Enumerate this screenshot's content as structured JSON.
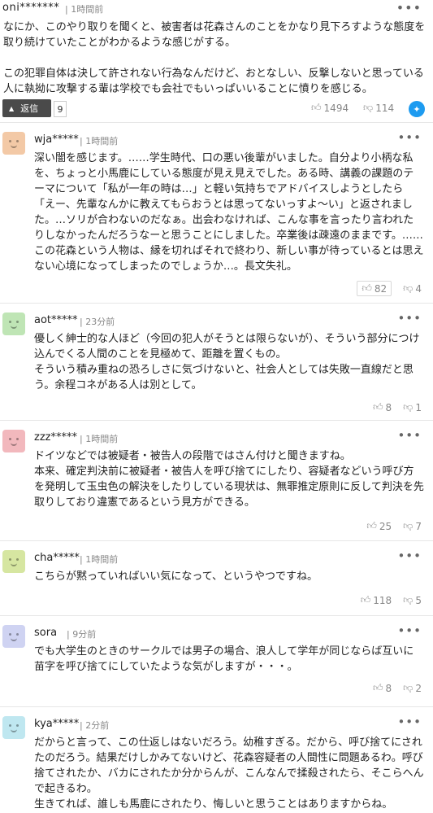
{
  "top_comment": {
    "user": "oni*******",
    "time": "1時間前",
    "paragraphs": [
      "なにか、このやり取りを聞くと、被害者は花森さんのことをかなり見下ろすような態度を取り続けていたことがわかるような感じがする。",
      "この犯罪自体は決して許されない行為なんだけど、おとなしい、反撃しないと思っている人に執拗に攻撃する輩は学校でも会社でもいっぱいいることに憤りを感じる。"
    ],
    "reply_label": "返信",
    "reply_count": "9",
    "likes": "1494",
    "dislikes": "114"
  },
  "replies": [
    {
      "user": "wja*****",
      "time": "1時間前",
      "avatar_color": "#f3c9a6",
      "text": "深い闇を感じます。……学生時代、口の悪い後輩がいました。自分より小柄な私を、ちょっと小馬鹿にしている態度が見え見えでした。ある時、講義の課題のテーマについて「私が一年の時は…」と軽い気持ちでアドバイスしようとしたら「えー、先輩なんかに教えてもらおうとは思ってないっすよ～い」と返されました。…ソリが合わないのだなぁ。出会わなければ、こんな事を言ったり言われたりしなかったんだろうなーと思うことにしました。卒業後は疎遠のままです。……この花森という人物は、縁を切ればそれで終わり、新しい事が待っているとは思えない心境になってしまったのでしょうか…。長文失礼。",
      "likes": "82",
      "dislikes": "4"
    },
    {
      "user": "aot*****",
      "time": "23分前",
      "avatar_color": "#bfe5b5",
      "text": "優しく紳士的な人ほど（今回の犯人がそうとは限らないが）、そういう部分につけ込んでくる人間のことを見極めて、距離を置くもの。\nそういう積み重ねの恐ろしさに気づけないと、社会人としては失敗一直線だと思う。余程コネがある人は別として。",
      "likes": "8",
      "dislikes": "1"
    },
    {
      "user": "zzz*****",
      "time": "1時間前",
      "avatar_color": "#f2b8bd",
      "text": "ドイツなどでは被疑者・被告人の段階ではさん付けと聞きますね。\n本来、確定判決前に被疑者・被告人を呼び捨てにしたり、容疑者などいう呼び方を発明して玉虫色の解決をしたりしている現状は、無罪推定原則に反して判決を先取りしており違憲であるという見方ができる。",
      "likes": "25",
      "dislikes": "7"
    },
    {
      "user": "cha*****",
      "time": "1時間前",
      "avatar_color": "#d6e6a1",
      "text": "こちらが黙っていればいい気になって、というやつですね。",
      "likes": "118",
      "dislikes": "5"
    },
    {
      "user": "sora",
      "time": "9分前",
      "avatar_color": "#cfd3f2",
      "text": "でも大学生のときのサークルでは男子の場合、浪人して学年が同じならば互いに苗字を呼び捨てにしていたような気がしますが・・・。",
      "likes": "8",
      "dislikes": "2"
    },
    {
      "user": "kya*****",
      "time": "2分前",
      "avatar_color": "#bfe7f0",
      "text": "だからと言って、この仕返しはないだろう。幼稚すぎる。だから、呼び捨てにされたのだろう。結果だけしかみてないけど、花森容疑者の人間性に問題あるわ。呼び捨てされたか、バカにされたか分からんが、こんなんで揉殺されたら、そこらへんで起きるわ。\n生きてれば、誰しも馬鹿にされたり、悔しいと思うことはありますからね。",
      "likes": "",
      "dislikes": ""
    }
  ]
}
